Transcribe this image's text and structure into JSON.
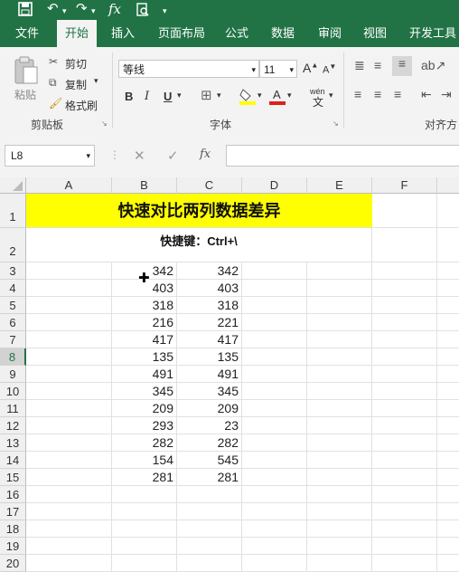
{
  "quick_access": {
    "icons": [
      "save-icon",
      "undo-icon",
      "redo-icon",
      "function-icon",
      "print-preview-icon",
      "customize-icon"
    ]
  },
  "tabs": [
    "文件",
    "开始",
    "插入",
    "页面布局",
    "公式",
    "数据",
    "审阅",
    "视图",
    "开发工具"
  ],
  "active_tab": "开始",
  "ribbon": {
    "clipboard": {
      "paste": "粘贴",
      "cut": "剪切",
      "copy": "复制",
      "format_painter": "格式刷",
      "group_label": "剪贴板"
    },
    "font": {
      "name": "等线",
      "size": "11",
      "bold": "B",
      "italic": "I",
      "underline": "U",
      "phonetic": "wén",
      "group_label": "字体"
    },
    "alignment": {
      "group_label": "对齐方"
    }
  },
  "formula_bar": {
    "name_box": "L8",
    "fx": "fx",
    "value": ""
  },
  "sheet": {
    "columns": [
      "A",
      "B",
      "C",
      "D",
      "E",
      "F"
    ],
    "rows": [
      "1",
      "2",
      "3",
      "4",
      "5",
      "6",
      "7",
      "8",
      "9",
      "10",
      "11",
      "12",
      "13",
      "14",
      "15",
      "16",
      "17",
      "18",
      "19",
      "20"
    ],
    "title": "快速对比两列数据差异",
    "subtitle": "快捷键：Ctrl+\\",
    "data": [
      [
        "342",
        "342"
      ],
      [
        "403",
        "403"
      ],
      [
        "318",
        "318"
      ],
      [
        "216",
        "221"
      ],
      [
        "417",
        "417"
      ],
      [
        "135",
        "135"
      ],
      [
        "491",
        "491"
      ],
      [
        "345",
        "345"
      ],
      [
        "209",
        "209"
      ],
      [
        "293",
        "23"
      ],
      [
        "282",
        "282"
      ],
      [
        "154",
        "545"
      ],
      [
        "281",
        "281"
      ]
    ],
    "title_bg": "#ffff00",
    "selected_row": "8",
    "accent": "#217346"
  }
}
